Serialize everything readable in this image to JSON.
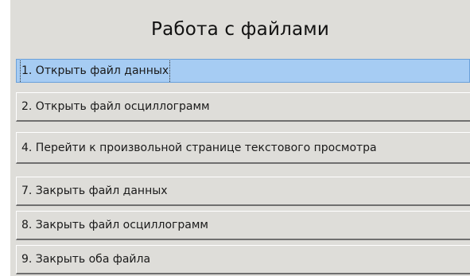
{
  "dialog": {
    "title": "Работа с файлами",
    "items": [
      {
        "label": "1. Открыть файл данных",
        "selected": true
      },
      {
        "label": "2. Открыть файл осциллограмм",
        "selected": false
      },
      {
        "label": "4. Перейти к произвольной странице текстового просмотра",
        "selected": false
      },
      {
        "label": "7. Закрыть файл данных",
        "selected": false
      },
      {
        "label": "8. Закрыть файл осциллограмм",
        "selected": false
      },
      {
        "label": "9. Закрыть оба файла",
        "selected": false
      }
    ]
  },
  "colors": {
    "panel_background": "#deddd9",
    "selection_background": "#a6ccf3",
    "selection_border": "#6aa0da"
  }
}
